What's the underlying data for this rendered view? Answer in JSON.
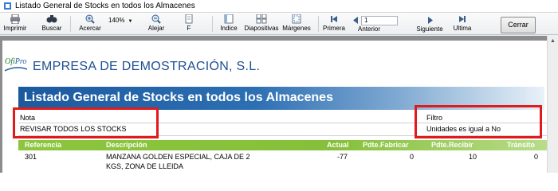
{
  "window": {
    "title": "Listado General de Stocks en todos los Almacenes"
  },
  "toolbar": {
    "imprimir": "Imprimir",
    "buscar": "Buscar",
    "acercar": "Acercar",
    "zoom": "140%",
    "alejar": "Alejar",
    "f": "F",
    "indice": "Indice",
    "diapositivas": "Diapositivas",
    "margenes": "Márgenes",
    "primera": "Primera",
    "anterior": "Anterior",
    "page": "1",
    "siguiente": "Siguiente",
    "ultima": "Ultima",
    "cerrar": "Cerrar"
  },
  "report": {
    "logo": "OfiPro",
    "company": "EMPRESA DE DEMOSTRACIÓN, S.L.",
    "title": "Listado General de Stocks en todos los Almacenes",
    "nota_label": "Nota",
    "nota_value": "REVISAR TODOS LOS STOCKS",
    "filtro_label": "Filtro",
    "filtro_value": "Unidades es igual a No"
  },
  "table": {
    "columns": [
      "Referencia",
      "Descripción",
      "Actual",
      "Pdte.Fabricar",
      "Pdte.Recibir",
      "Tránsito"
    ],
    "rows": [
      {
        "referencia": "301",
        "descripcion_l1": "MANZANA GOLDEN ESPECIAL, CAJA DE 2",
        "descripcion_l2": "KGS, ZONA DE LLEIDA",
        "actual": "-77",
        "pdte_fabricar": "0",
        "pdte_recibir": "10",
        "transito": "0"
      }
    ]
  },
  "colors": {
    "brand_blue": "#1e4f93",
    "header_green": "#8cc63e",
    "highlight_red": "#e01b1b"
  }
}
